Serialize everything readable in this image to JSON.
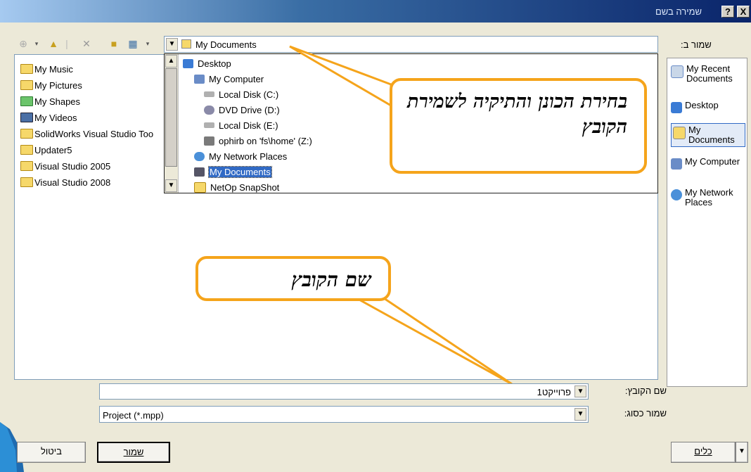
{
  "window": {
    "title": "שמירה בשם",
    "help_label": "?",
    "close_label": "X"
  },
  "save_in": {
    "label": "שמור ב:",
    "value": "My Documents"
  },
  "toolbar": {
    "back_icon": "back-icon",
    "up_icon": "up-folder-icon",
    "delete_icon": "delete-icon",
    "new_folder_icon": "new-folder-icon",
    "views_icon": "views-icon"
  },
  "files": [
    "My Music",
    "My Pictures",
    "My Shapes",
    "My Videos",
    "SolidWorks Visual Studio Too",
    "Updater5",
    "Visual Studio 2005",
    "Visual Studio 2008"
  ],
  "dropdown_items": [
    {
      "label": "Desktop",
      "indent": 0
    },
    {
      "label": "My Computer",
      "indent": 1
    },
    {
      "label": "Local Disk (C:)",
      "indent": 2
    },
    {
      "label": "DVD Drive (D:)",
      "indent": 2
    },
    {
      "label": "Local Disk (E:)",
      "indent": 2
    },
    {
      "label": "ophirb on 'fs\\home' (Z:)",
      "indent": 2
    },
    {
      "label": "My Network Places",
      "indent": 1
    },
    {
      "label": "My Documents",
      "indent": 1,
      "selected": true
    },
    {
      "label": "NetOp SnapShot",
      "indent": 1
    }
  ],
  "places": [
    {
      "label": "My Recent Documents"
    },
    {
      "label": "Desktop"
    },
    {
      "label": "My Documents",
      "selected": true
    },
    {
      "label": "My Computer"
    },
    {
      "label": "My Network Places"
    }
  ],
  "callouts": {
    "location": "בחירת הכונן והתיקיה לשמירת הקובץ",
    "filename": "שם הקובץ"
  },
  "filename": {
    "label": "שם הקובץ:",
    "value": "פרוייקט1"
  },
  "save_as_type": {
    "label": "שמור כסוג:",
    "value": "Project (*.mpp)"
  },
  "buttons": {
    "save": "שמור",
    "cancel": "ביטול",
    "tools": "כלים"
  },
  "colors": {
    "accent": "#f5a41b",
    "titlebar": "#0a246a",
    "selection": "#316ac5"
  }
}
